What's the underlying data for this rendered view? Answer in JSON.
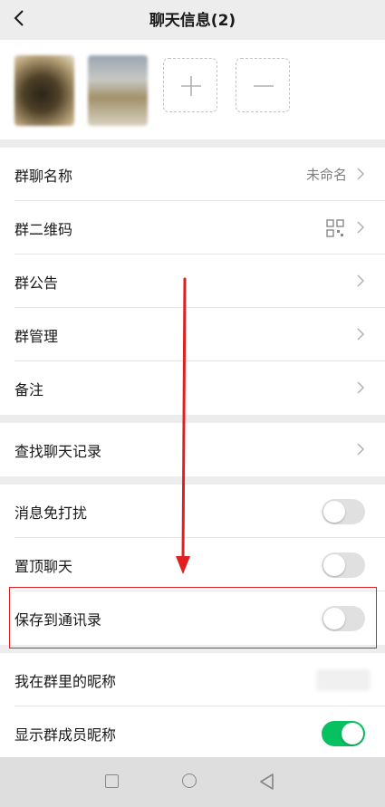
{
  "header": {
    "title": "聊天信息(2)"
  },
  "group1": [
    {
      "label": "群聊名称",
      "value": "未命名"
    },
    {
      "label": "群二维码"
    },
    {
      "label": "群公告"
    },
    {
      "label": "群管理"
    },
    {
      "label": "备注"
    }
  ],
  "group2": [
    {
      "label": "查找聊天记录"
    }
  ],
  "group3": [
    {
      "label": "消息免打扰",
      "toggle_on": false
    },
    {
      "label": "置顶聊天",
      "toggle_on": false
    },
    {
      "label": "保存到通讯录",
      "toggle_on": false
    }
  ],
  "group4": [
    {
      "label": "我在群里的昵称"
    },
    {
      "label": "显示群成员昵称",
      "toggle_on": true
    }
  ],
  "colors": {
    "accent_green": "#07c160",
    "annotation_red": "#e02020",
    "background": "#ededed"
  },
  "icons": [
    "back-chevron-icon",
    "plus-icon",
    "minus-icon",
    "qr-code-icon",
    "chevron-right-icon",
    "nav-square-icon",
    "nav-circle-icon",
    "nav-back-triangle-icon"
  ]
}
